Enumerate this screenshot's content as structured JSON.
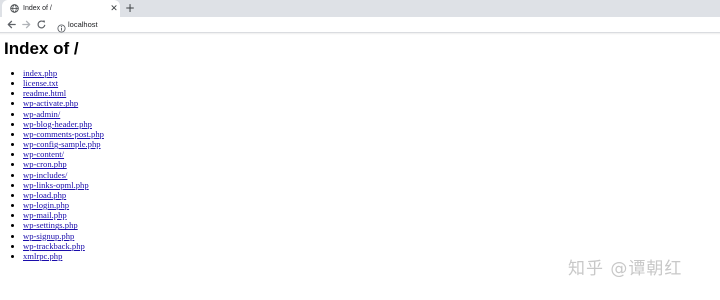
{
  "browser": {
    "tab": {
      "title": "Index of /",
      "close_glyph": "✕",
      "favicon": "globe-icon"
    },
    "new_tab_glyph": "+",
    "nav": {
      "back": "arrow-left-icon",
      "forward": "arrow-right-icon",
      "reload": "reload-icon"
    },
    "address": {
      "url": "localhost",
      "icon": "info-icon"
    }
  },
  "page": {
    "title": "Index of /",
    "files": [
      "index.php",
      "license.txt",
      "readme.html",
      "wp-activate.php",
      "wp-admin/",
      "wp-blog-header.php",
      "wp-comments-post.php",
      "wp-config-sample.php",
      "wp-content/",
      "wp-cron.php",
      "wp-includes/",
      "wp-links-opml.php",
      "wp-load.php",
      "wp-login.php",
      "wp-mail.php",
      "wp-settings.php",
      "wp-signup.php",
      "wp-trackback.php",
      "xmlrpc.php"
    ]
  },
  "watermark": "知乎 @谭朝红",
  "colors": {
    "tabbar_bg": "#dee1e6",
    "link": "#1a0dab",
    "watermark": "#c8c8c8"
  }
}
